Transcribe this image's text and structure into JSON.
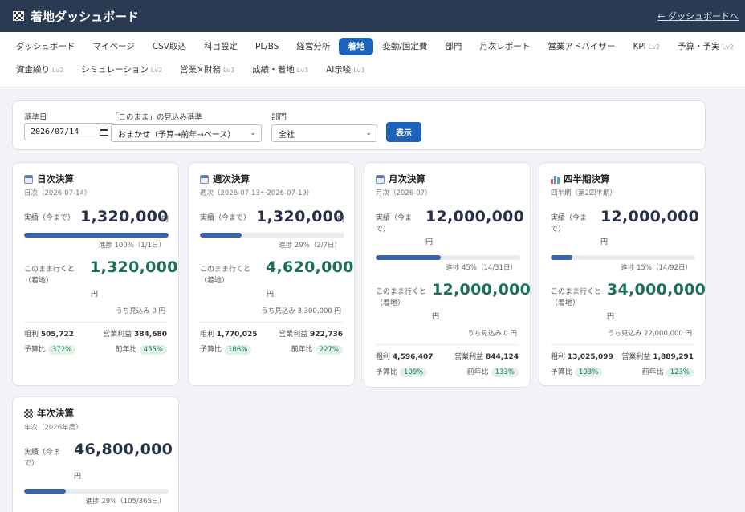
{
  "header": {
    "title": "着地ダッシュボード",
    "back_link": "← ダッシュボードへ"
  },
  "nav": {
    "row1": [
      {
        "label": "ダッシュボード",
        "lv": ""
      },
      {
        "label": "マイページ",
        "lv": ""
      },
      {
        "label": "CSV取込",
        "lv": ""
      },
      {
        "label": "科目設定",
        "lv": ""
      },
      {
        "label": "PL/BS",
        "lv": ""
      },
      {
        "label": "経営分析",
        "lv": ""
      },
      {
        "label": "着地",
        "lv": "",
        "active": true
      },
      {
        "label": "変動/固定費",
        "lv": ""
      },
      {
        "label": "部門",
        "lv": ""
      },
      {
        "label": "月次レポート",
        "lv": ""
      },
      {
        "label": "営業アドバイザー",
        "lv": ""
      },
      {
        "label": "KPI",
        "lv": "Lv2"
      },
      {
        "label": "予算・予実",
        "lv": "Lv2"
      }
    ],
    "row2": [
      {
        "label": "資金繰り",
        "lv": "Lv2"
      },
      {
        "label": "シミュレーション",
        "lv": "Lv2"
      },
      {
        "label": "営業×財務",
        "lv": "Lv3"
      },
      {
        "label": "成績・着地",
        "lv": "Lv3"
      },
      {
        "label": "AI示唆",
        "lv": "Lv3"
      }
    ]
  },
  "filters": {
    "base_date_label": "基準日",
    "base_date_value": "2026/07/14",
    "basis_label": "「このまま」の見込み基準",
    "basis_value": "おまかせ（予算→前年→ペース）",
    "dept_label": "部門",
    "dept_value": "全社",
    "show_button": "表示"
  },
  "cards": {
    "daily": {
      "icon": "calendar-icon",
      "title": "日次決算",
      "subtitle": "日次（2026-07-14）",
      "actual_label": "実績（今まで）",
      "actual": "1,320,000",
      "unit": "円",
      "progress": 1.0,
      "progress_text": "進捗 100%（1/1日）",
      "forecast_label": "このまま行くと（着地）",
      "forecast": "1,320,000",
      "incl_text": "うち見込み 0 円",
      "gross_label": "粗利",
      "gross": "505,722",
      "op_label": "営業利益",
      "op": "384,680",
      "budget_label": "予算比",
      "budget": "372%",
      "yoy_label": "前年比",
      "yoy": "455%"
    },
    "weekly": {
      "icon": "calendar-icon",
      "title": "週次決算",
      "subtitle": "週次（2026-07-13〜2026-07-19）",
      "actual_label": "実績（今まで）",
      "actual": "1,320,000",
      "unit": "円",
      "progress": 0.29,
      "progress_text": "進捗 29%（2/7日）",
      "forecast_label": "このまま行くと（着地）",
      "forecast": "4,620,000",
      "incl_text": "うち見込み 3,300,000 円",
      "gross_label": "粗利",
      "gross": "1,770,025",
      "op_label": "営業利益",
      "op": "922,736",
      "budget_label": "予算比",
      "budget": "186%",
      "yoy_label": "前年比",
      "yoy": "227%"
    },
    "monthly": {
      "icon": "calendar-icon",
      "title": "月次決算",
      "subtitle": "月次（2026-07）",
      "actual_label": "実績（今まで）",
      "actual": "12,000,000",
      "unit": "円",
      "progress": 0.45,
      "progress_text": "進捗 45%（14/31日）",
      "forecast_label": "このまま行くと（着地）",
      "forecast": "12,000,000",
      "incl_text": "うち見込み 0 円",
      "gross_label": "粗利",
      "gross": "4,596,407",
      "op_label": "営業利益",
      "op": "844,124",
      "budget_label": "予算比",
      "budget": "109%",
      "yoy_label": "前年比",
      "yoy": "133%"
    },
    "quarterly": {
      "icon": "bar-chart-icon",
      "title": "四半期決算",
      "subtitle": "四半期（第2四半期）",
      "actual_label": "実績（今まで）",
      "actual": "12,000,000",
      "unit": "円",
      "progress": 0.15,
      "progress_text": "進捗 15%（14/92日）",
      "forecast_label": "このまま行くと（着地）",
      "forecast": "34,000,000",
      "incl_text": "うち見込み 22,000,000 円",
      "gross_label": "粗利",
      "gross": "13,025,099",
      "op_label": "営業利益",
      "op": "1,889,291",
      "budget_label": "予算比",
      "budget": "103%",
      "yoy_label": "前年比",
      "yoy": "123%"
    },
    "yearly": {
      "icon": "checkered-flag-icon",
      "title": "年次決算",
      "subtitle": "年次（2026年度）",
      "actual_label": "実績（今まで）",
      "actual": "46,800,000",
      "unit": "円",
      "progress": 0.29,
      "progress_text": "進捗 29%（105/365日）"
    }
  }
}
